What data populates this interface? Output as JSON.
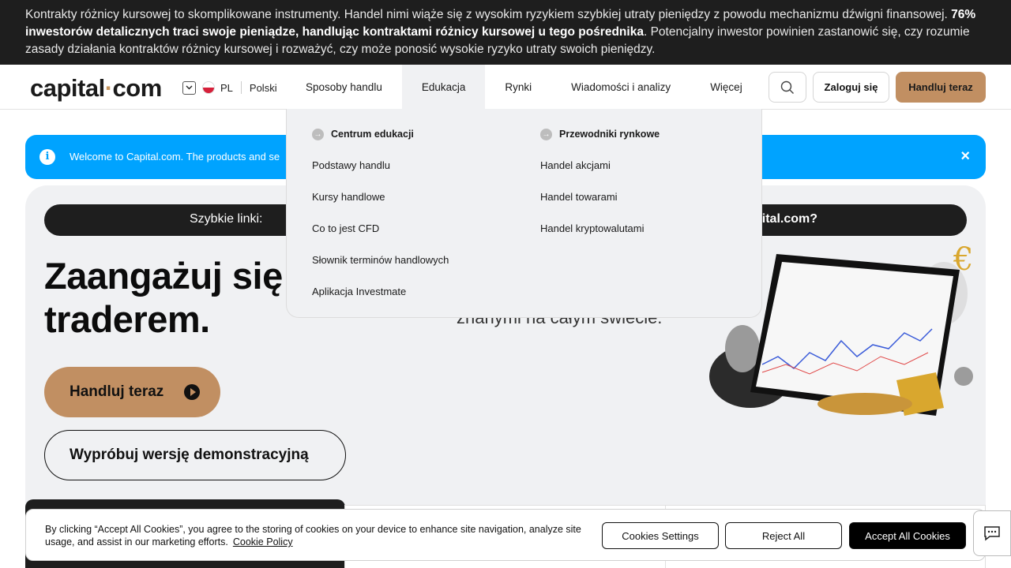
{
  "risk_banner": {
    "text_before": "Kontrakty różnicy kursowej to skomplikowane instrumenty. Handel nimi wiąże się z wysokim ryzykiem szybkiej utraty pieniędzy z powodu mechanizmu dźwigni finansowej. ",
    "text_bold": "76% inwestorów detalicznych traci swoje pieniądze, handlując kontraktami różnicy kursowej u tego pośrednika",
    "text_after": ". Potencjalny inwestor powinien zastanowić się, czy rozumie zasady działania kontraktów różnicy kursowej i rozważyć, czy może ponosić wysokie ryzyko utraty swoich pieniędzy."
  },
  "header": {
    "logo_left": "capital",
    "logo_dot": "·",
    "logo_right": "com",
    "lang_code": "PL",
    "lang_name": "Polski",
    "nav": [
      "Sposoby handlu",
      "Edukacja",
      "Rynki",
      "Wiadomości i analizy",
      "Więcej"
    ],
    "active_nav": "Edukacja",
    "login_label": "Zaloguj się",
    "trade_label": "Handluj teraz"
  },
  "dropdown": {
    "col1_title": "Centrum edukacji",
    "col1_links": [
      "Podstawy handlu",
      "Kursy handlowe",
      "Co to jest CFD",
      "Słownik terminów handlowych",
      "Aplikacja Investmate"
    ],
    "col2_title": "Przewodniki rynkowe",
    "col2_links": [
      "Handel akcjami",
      "Handel towarami",
      "Handel kryptowalutami"
    ]
  },
  "welcome": {
    "text": "Welcome to Capital.com. The products and se",
    "close": "×"
  },
  "hero": {
    "quick_links_label": "Szybkie linki:",
    "quick_links_right": "pital.com?",
    "headline_line1": "Zaangażuj się",
    "headline_line2": "traderem.",
    "subline": "znanymi na całym świecie.",
    "trade_button": "Handluj teraz",
    "demo_button": "Wypróbuj wersję demonstracyjną"
  },
  "cookie": {
    "text": "By clicking “Accept All Cookies”, you agree to the storing of cookies on your device to enhance site navigation, analyze site usage, and assist in our marketing efforts.",
    "policy_link": "Cookie Policy",
    "settings": "Cookies Settings",
    "reject": "Reject All",
    "accept": "Accept All Cookies"
  },
  "colors": {
    "accent": "#c18f62",
    "info_blue": "#00a3ff",
    "dark": "#1e1e1e"
  },
  "icons": [
    "chevron-down-icon",
    "poland-flag-icon",
    "search-icon",
    "info-icon",
    "close-icon",
    "arrow-right-icon",
    "play-icon",
    "chat-icon"
  ]
}
